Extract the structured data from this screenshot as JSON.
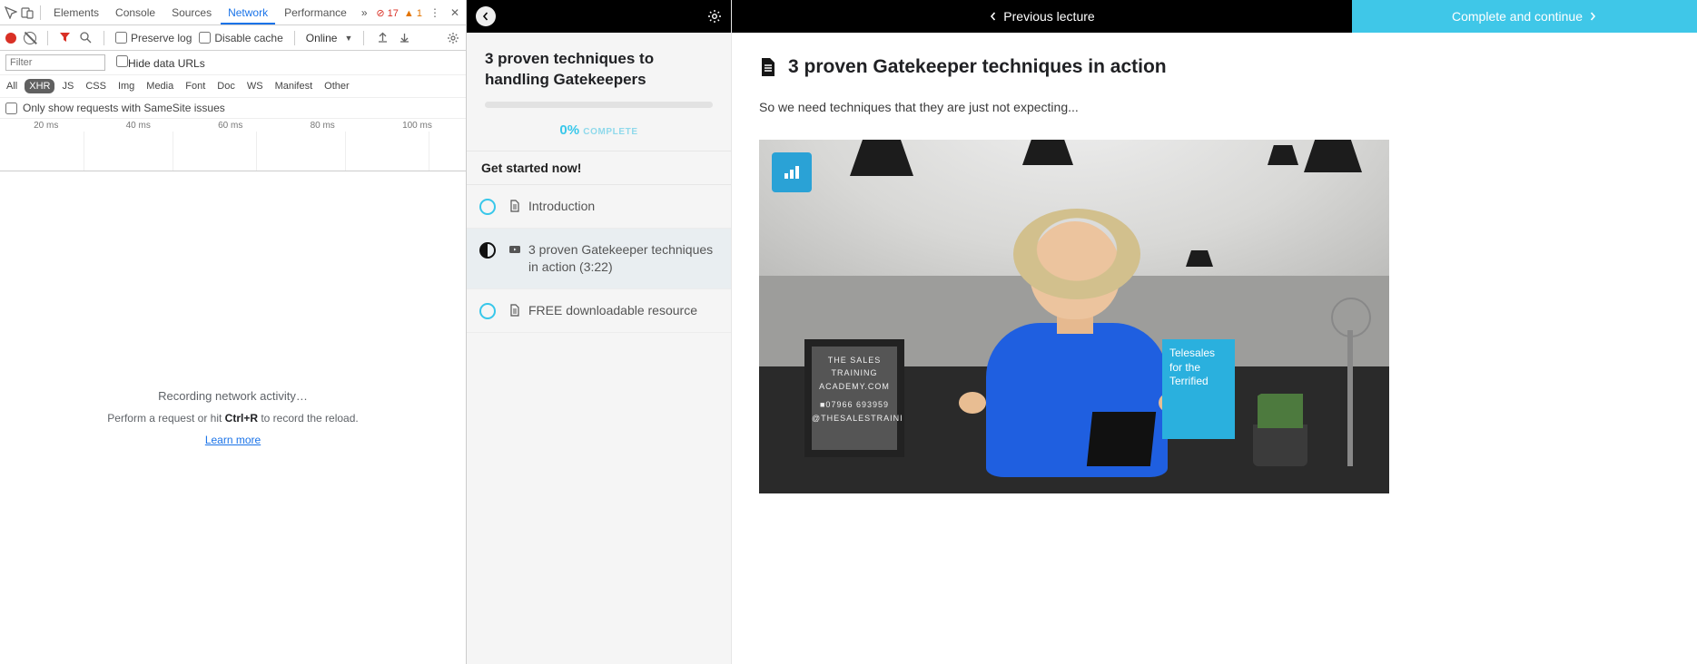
{
  "devtools": {
    "tabs": [
      "Elements",
      "Console",
      "Sources",
      "Network",
      "Performance"
    ],
    "activeTab": "Network",
    "errorsCount": "17",
    "warningsCount": "1",
    "toolbar": {
      "preserveLog": "Preserve log",
      "disableCache": "Disable cache",
      "throttling": "Online"
    },
    "filter": {
      "placeholder": "Filter",
      "hideDataUrls": "Hide data URLs"
    },
    "types": [
      "All",
      "XHR",
      "JS",
      "CSS",
      "Img",
      "Media",
      "Font",
      "Doc",
      "WS",
      "Manifest",
      "Other"
    ],
    "typesActive": "XHR",
    "sameSite": "Only show requests with SameSite issues",
    "timelineMarks": [
      "20 ms",
      "40 ms",
      "60 ms",
      "80 ms",
      "100 ms"
    ],
    "mainTitle": "Recording network activity…",
    "mainSub_pre": "Perform a request or hit ",
    "mainSub_key": "Ctrl+R",
    "mainSub_post": " to record the reload.",
    "learnMore": "Learn more"
  },
  "course": {
    "title": "3 proven techniques to handling Gatekeepers",
    "percent": "0%",
    "completeWord": "COMPLETE",
    "sectionHeader": "Get started now!",
    "items": [
      {
        "label": "Introduction",
        "icon": "file",
        "state": "empty"
      },
      {
        "label": "3 proven Gatekeeper techniques in action (3:22)",
        "icon": "video",
        "state": "current"
      },
      {
        "label": "FREE downloadable resource",
        "icon": "file",
        "state": "empty"
      }
    ]
  },
  "main": {
    "prev": "Previous lecture",
    "next": "Complete and continue",
    "heading": "3 proven Gatekeeper techniques in action",
    "paragraph": "So we need techniques that they are just not expecting...",
    "boardLines": [
      "THE SALES",
      "TRAINING",
      "ACADEMY.COM",
      "■07966 693959",
      "@THESALESTRAINI"
    ],
    "bookLines": [
      "Telesales",
      "for the",
      "Terrified"
    ]
  }
}
